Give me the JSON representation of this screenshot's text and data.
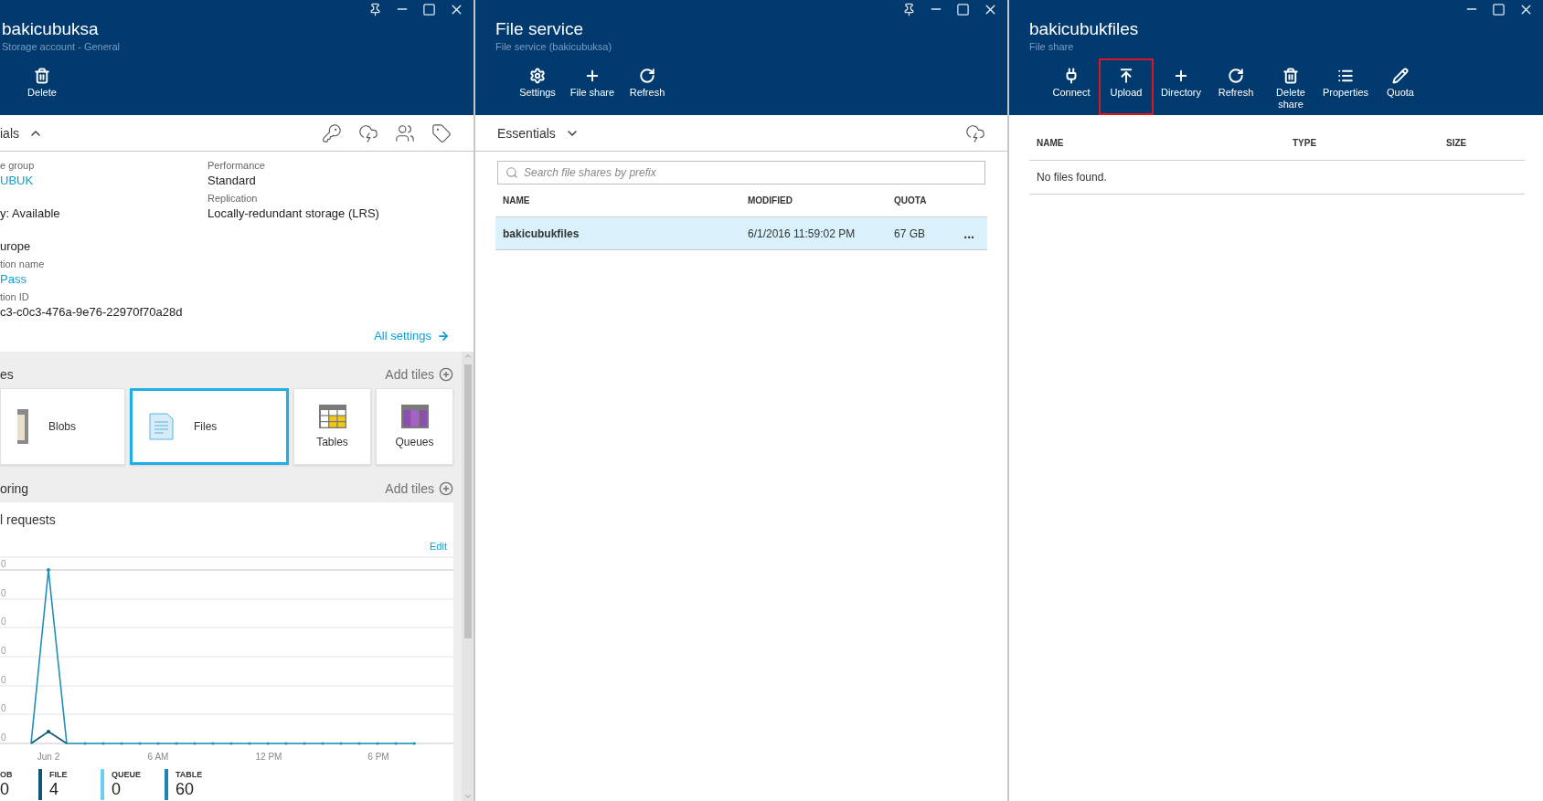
{
  "storage_account_blade": {
    "header": {
      "title": "bakicubuksa",
      "subtitle": "Storage account - General",
      "pinnable": true,
      "commands": [
        {
          "label": "Delete",
          "highlighted": false
        }
      ]
    },
    "essentials": {
      "label": "ials",
      "expanded": true
    },
    "properties_left": [
      {
        "label": "e group",
        "value": "UBUK",
        "link": true
      },
      {
        "value": "y: Available",
        "link": false
      },
      {
        "value": "urope",
        "link": false
      },
      {
        "label": "tion name",
        "value": "Pass",
        "link": true
      },
      {
        "label": "tion ID",
        "value": "c3-c0c3-476a-9e76-22970f70a28d",
        "link": false
      }
    ],
    "properties_right": [
      {
        "label": "Performance",
        "value": "Standard",
        "link": false
      },
      {
        "label": "Replication",
        "value": "Locally-redundant storage (LRS)",
        "link": false
      }
    ],
    "all_settings": "All settings",
    "services": {
      "heading": "es",
      "add_tiles": "Add tiles",
      "tiles": [
        {
          "label": "Blobs",
          "kind": "wide",
          "selected": false
        },
        {
          "label": "Files",
          "kind": "wide",
          "selected": true
        },
        {
          "label": "Tables",
          "kind": "tall",
          "selected": false
        },
        {
          "label": "Queues",
          "kind": "tall",
          "selected": false
        }
      ]
    },
    "monitoring": {
      "heading": "oring",
      "add_tiles": "Add tiles",
      "card": {
        "title": "l requests",
        "edit": "Edit",
        "y_axis_labels": [
          "0",
          "0",
          "0",
          "0",
          "0",
          "0",
          "0"
        ],
        "x_axis_labels": [
          "Jun 2",
          "6 AM",
          "12 PM",
          "6 PM"
        ],
        "stats": [
          {
            "label": "OB",
            "value": "0"
          },
          {
            "label": "FILE",
            "value": "4",
            "color": "#0e5877"
          },
          {
            "label": "QUEUE",
            "value": "0",
            "color": "#6dcff6"
          },
          {
            "label": "TABLE",
            "value": "60",
            "color": "#1b86b3"
          }
        ]
      }
    }
  },
  "file_service_blade": {
    "header": {
      "title": "File service",
      "subtitle": "File service (bakicubuksa)",
      "pinnable": true,
      "commands": [
        {
          "label": "Settings",
          "highlighted": false
        },
        {
          "label": "File share",
          "highlighted": false
        },
        {
          "label": "Refresh",
          "highlighted": false
        }
      ]
    },
    "essentials": {
      "label": "Essentials",
      "expanded": false
    },
    "search": {
      "placeholder": "Search file shares by prefix"
    },
    "table": {
      "columns": [
        "NAME",
        "MODIFIED",
        "QUOTA"
      ],
      "rows": [
        {
          "name": "bakicubukfiles",
          "modified": "6/1/2016 11:59:02 PM",
          "quota": "67 GB",
          "menu": "...",
          "selected": true
        }
      ]
    }
  },
  "file_share_blade": {
    "header": {
      "title": "bakicubukfiles",
      "subtitle": "File share",
      "pinnable": false,
      "commands": [
        {
          "label": "Connect",
          "highlighted": false
        },
        {
          "label": "Upload",
          "highlighted": true
        },
        {
          "label": "Directory",
          "highlighted": false
        },
        {
          "label": "Refresh",
          "highlighted": false
        },
        {
          "label": "Delete share",
          "highlighted": false
        },
        {
          "label": "Properties",
          "highlighted": false
        },
        {
          "label": "Quota",
          "highlighted": false
        }
      ]
    },
    "table": {
      "columns": [
        "NAME",
        "TYPE",
        "SIZE"
      ],
      "empty_message": "No files found."
    }
  }
}
